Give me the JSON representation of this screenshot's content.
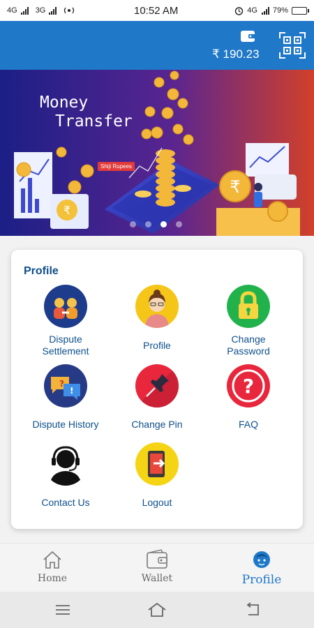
{
  "status_bar": {
    "left_labels": [
      "4G",
      "3G"
    ],
    "time": "10:52 AM",
    "right_label": "4G",
    "battery": "79%",
    "battery_level": 0.79
  },
  "header": {
    "balance": "₹ 190.23",
    "icons": [
      "wallet-icon",
      "qr-code-icon"
    ]
  },
  "banner": {
    "title_line1": "Money",
    "title_line2": "Transfer",
    "chip": "Shiji Rupees",
    "slide_count": 4,
    "active_slide": 2
  },
  "profile_card": {
    "title": "Profile",
    "items": [
      {
        "label": "Dispute\nSettlement",
        "icon": "dispute-settlement-icon"
      },
      {
        "label": "Profile",
        "icon": "profile-avatar-icon"
      },
      {
        "label": "Change\nPassword",
        "icon": "lock-icon"
      },
      {
        "label": "Dispute History",
        "icon": "chat-bubbles-icon"
      },
      {
        "label": "Change Pin",
        "icon": "pin-icon"
      },
      {
        "label": "FAQ",
        "icon": "question-mark-icon"
      },
      {
        "label": "Contact Us",
        "icon": "headset-icon"
      },
      {
        "label": "Logout",
        "icon": "logout-icon"
      }
    ]
  },
  "bottom_nav": {
    "items": [
      {
        "label": "Home",
        "icon": "home-icon"
      },
      {
        "label": "Wallet",
        "icon": "wallet-icon"
      },
      {
        "label": "Profile",
        "icon": "profile-face-icon"
      }
    ],
    "active": "Profile"
  },
  "colors": {
    "header_blue": "#1f78c8",
    "text_blue": "#0d4f8b",
    "banner_start": "#1b1f86",
    "banner_end": "#d2402a"
  },
  "system_nav": [
    "menu-icon",
    "home-icon",
    "back-icon"
  ]
}
